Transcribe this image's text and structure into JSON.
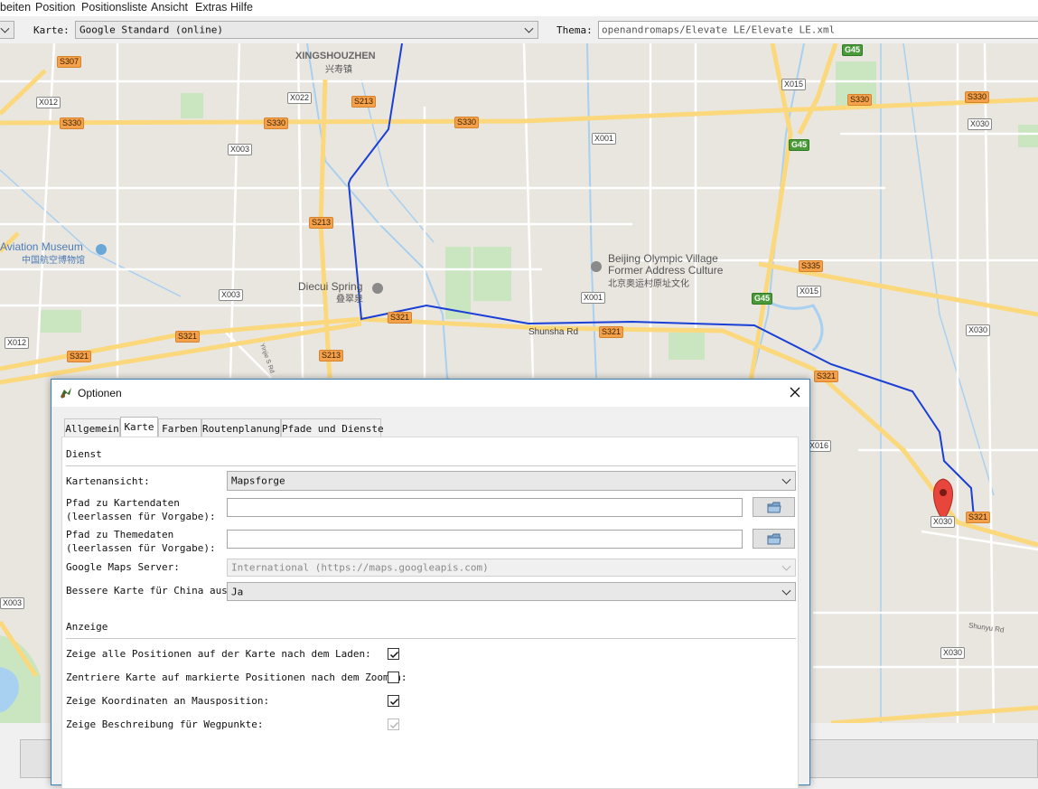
{
  "menubar": {
    "items": [
      "beiten",
      "Position",
      "Positionsliste",
      "Ansicht",
      "Extras",
      "Hilfe"
    ]
  },
  "toolbar": {
    "map_label": "Karte:",
    "map_value": "Google Standard (online)",
    "theme_label": "Thema:",
    "theme_value": "openandromaps/Elevate LE/Elevate LE.xml"
  },
  "map": {
    "place_labels": {
      "xingshouzhen": "XINGSHOUZHEN",
      "xingshouzhen_cn": "兴寿镇",
      "aviation_museum": "Aviation Museum",
      "aviation_museum_cn": "中国航空博物馆",
      "diecui_spring": "Diecui Spring",
      "diecui_spring_cn": "叠翠泉",
      "olympic_village_1": "Beijing Olympic Village",
      "olympic_village_2": "Former Address Culture",
      "olympic_village_cn": "北京奥运村原址文化",
      "shunsha_rd": "Shunsha Rd",
      "shunyu_rd": "Shunyu Rd",
      "yinjie": "Yinjie S Rd"
    },
    "shields": {
      "s307": "S307",
      "x012a": "X012",
      "s330a": "S330",
      "x022": "X022",
      "s213a": "S213",
      "s330b": "S330",
      "s330c": "S330",
      "x003a": "X003",
      "s213b": "S213",
      "x001a": "X001",
      "g45a": "G45",
      "x015a": "X015",
      "s330d": "S330",
      "s330e": "S330",
      "x030a": "X030",
      "g45b": "G45",
      "s335": "S335",
      "x015b": "X015",
      "g45c": "G45",
      "x003b": "X003",
      "x001b": "X001",
      "s321a": "S321",
      "s321b": "S321",
      "s321c": "S321",
      "x012b": "X012",
      "s321d": "S321",
      "s213c": "S213",
      "x030b": "X030",
      "s321e": "S321",
      "x016": "X016",
      "x030c": "X030",
      "s321f": "S321",
      "x003c": "X003",
      "x030d": "X030"
    }
  },
  "dialog": {
    "title": "Optionen",
    "tabs": [
      "Allgemein",
      "Karte",
      "Farben",
      "Routenplanung",
      "Pfade und Dienste"
    ],
    "active_tab": "Karte",
    "section_service": "Dienst",
    "map_view_label": "Kartenansicht:",
    "map_view_value": "Mapsforge",
    "map_data_label_1": "Pfad zu Kartendaten",
    "map_data_label_2": "(leerlassen für Vorgabe):",
    "map_data_value": "",
    "theme_data_label_1": "Pfad zu Themedaten",
    "theme_data_label_2": "(leerlassen für Vorgabe):",
    "theme_data_value": "",
    "gmaps_server_label": "Google Maps Server:",
    "gmaps_server_value": "International (https://maps.googleapis.com)",
    "better_china_label": "Bessere Karte für China aus:",
    "better_china_value": "Ja",
    "section_display": "Anzeige",
    "cb_show_all_label": "Zeige alle Positionen auf der Karte nach dem Laden:",
    "cb_show_all": true,
    "cb_center_label": "Zentriere Karte auf markierte Positionen nach dem Zoomen:",
    "cb_center": false,
    "cb_coords_label": "Zeige Koordinaten an Mausposition:",
    "cb_coords": true,
    "cb_desc_label": "Zeige Beschreibung für Wegpunkte:",
    "cb_desc": true,
    "cb_desc_disabled": true
  },
  "colors": {
    "route": "#1a3fd6",
    "marker": "#e8453c",
    "dialog_border": "#3c7fb1"
  }
}
